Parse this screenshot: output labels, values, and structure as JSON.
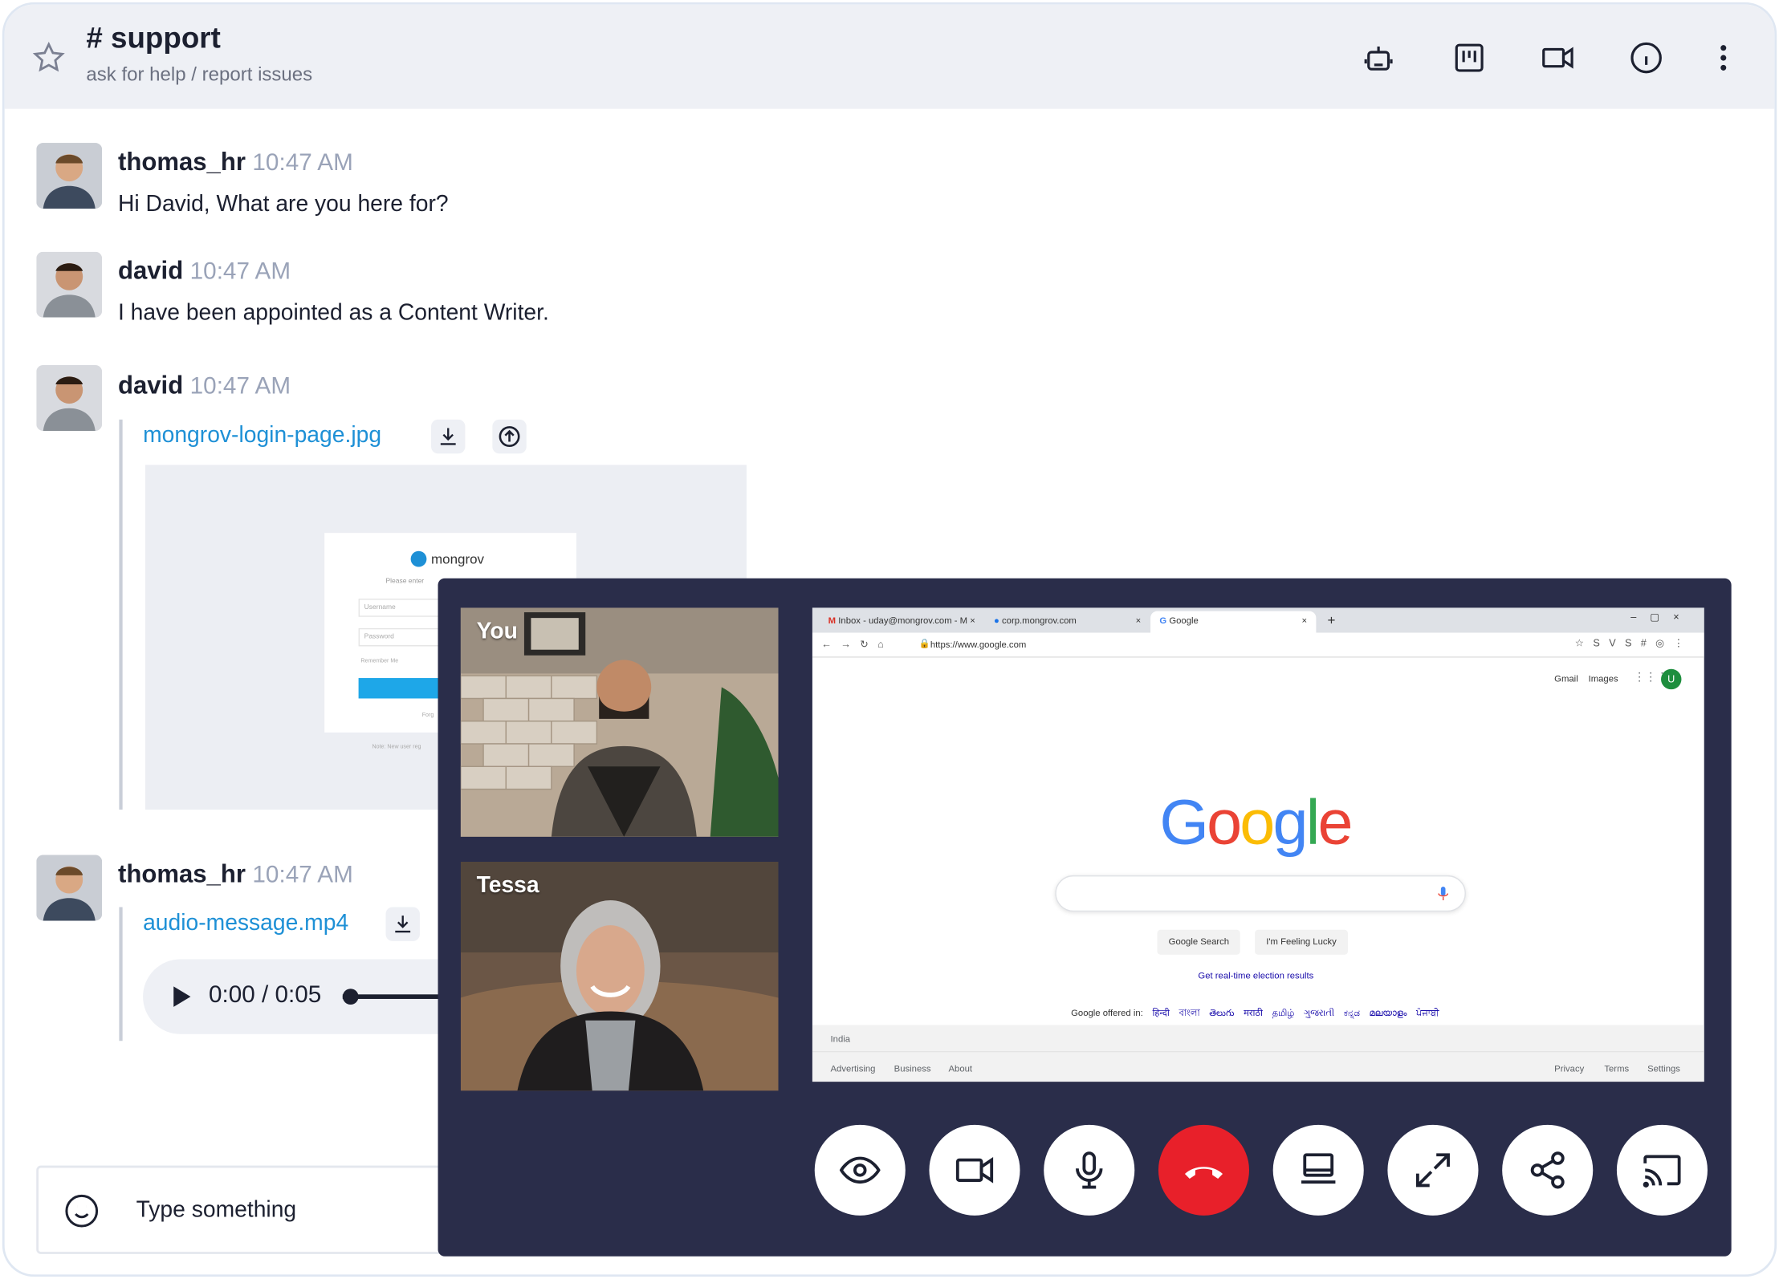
{
  "header": {
    "title": "# support",
    "subtitle": "ask for help / report issues"
  },
  "messages": [
    {
      "user": "thomas_hr",
      "time": "10:47 AM",
      "text": "Hi David, What are you here for?"
    },
    {
      "user": "david",
      "time": "10:47 AM",
      "text": "I have been appointed as a Content Writer."
    },
    {
      "user": "david",
      "time": "10:47 AM",
      "file": "mongrov-login-page.jpg"
    },
    {
      "user": "thomas_hr",
      "time": "10:47 AM",
      "file": "audio-message.mp4",
      "audio_time": "0:00 / 0:05"
    }
  ],
  "preview": {
    "brand": "mongrov",
    "prompt": "Please enter",
    "username_placeholder": "Username",
    "password_placeholder": "Password",
    "remember": "Remember Me",
    "forgot": "Forg",
    "note": "Note: New user reg"
  },
  "composer": {
    "placeholder": "Type something"
  },
  "call": {
    "participants": [
      {
        "label": "You"
      },
      {
        "label": "Tessa"
      }
    ],
    "controls": [
      "eye-icon",
      "video-camera-icon",
      "microphone-icon",
      "end-call-icon",
      "screen-share-icon",
      "expand-icon",
      "share-icon",
      "cast-icon"
    ],
    "end_call_color": "#e8202a"
  },
  "browser": {
    "tabs": [
      "Inbox - uday@mongrov.com - M",
      "corp.mongrov.com",
      "Google"
    ],
    "url": "https://www.google.com",
    "top_links": [
      "Gmail",
      "Images"
    ],
    "account_initial": "U",
    "logo": "Google",
    "buttons": [
      "Google Search",
      "I'm Feeling Lucky"
    ],
    "promo_link": "Get real-time election results",
    "offered_in": "Google offered in:",
    "languages": [
      "हिन्दी",
      "বাংলা",
      "తెలుగు",
      "मराठी",
      "தமிழ்",
      "ગુજરાતી",
      "ಕನ್ನಡ",
      "മലയാളം",
      "ਪੰਜਾਬੀ"
    ],
    "country": "India",
    "footer_left": [
      "Advertising",
      "Business",
      "About"
    ],
    "footer_right": [
      "Privacy",
      "Terms",
      "Settings"
    ]
  },
  "colors": {
    "accent": "#1e90d6",
    "panel": "#2a2d4a",
    "header_bg": "#eef0f5"
  }
}
